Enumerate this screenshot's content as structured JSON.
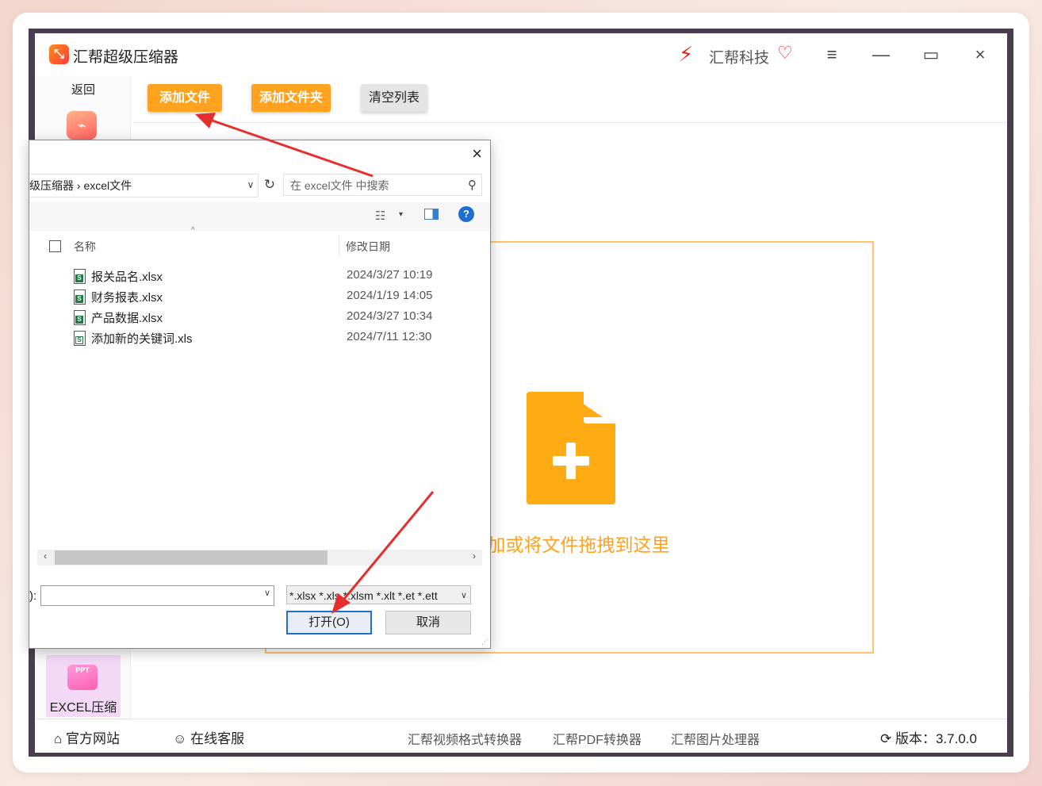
{
  "app": {
    "title": "汇帮超级压缩器",
    "logo_glyph": "⤡",
    "brand": "汇帮科技",
    "brand_icon": "lightning-logo-icon",
    "vip_icon": "diamond-heart-icon",
    "controls": {
      "menu": "≡",
      "minimize": "—",
      "maximize": "▭",
      "close": "×"
    }
  },
  "sidebar": {
    "back": "返回",
    "excel_label": "EXCEL压缩",
    "excel_icon_text": "PPT"
  },
  "toolbar": {
    "add_file": "添加文件",
    "add_folder": "添加文件夹",
    "clear_list": "清空列表"
  },
  "dropzone": {
    "text": "添加或将文件拖拽到这里",
    "color": "#ffa21f"
  },
  "statusbar": {
    "website": "官方网站",
    "support": "在线客服",
    "links": [
      "汇帮视频格式转换器",
      "汇帮PDF转换器",
      "汇帮图片处理器"
    ],
    "version_label": "版本：3.7.0.0"
  },
  "dialog": {
    "close": "×",
    "address": "级压缩器  ›  excel文件",
    "search_placeholder": "在 excel文件 中搜索",
    "columns": {
      "name": "名称",
      "date": "修改日期"
    },
    "files": [
      {
        "name": "报关品名.xlsx",
        "date": "2024/3/27 10:19"
      },
      {
        "name": "财务报表.xlsx",
        "date": "2024/1/19 14:05"
      },
      {
        "name": "产品数据.xlsx",
        "date": "2024/3/27 10:34"
      },
      {
        "name": "添加新的关键词.xls",
        "date": "2024/7/11 12:30"
      }
    ],
    "filename_label": "):",
    "filename_value": "",
    "filter": "*.xlsx *.xls *.xlsm *.xlt *.et *.ett",
    "open": "打开(O)",
    "cancel": "取消"
  },
  "colors": {
    "accent": "#ffa21f",
    "arrow": "#e52e2e",
    "primary_blue": "#1f6fd0"
  }
}
